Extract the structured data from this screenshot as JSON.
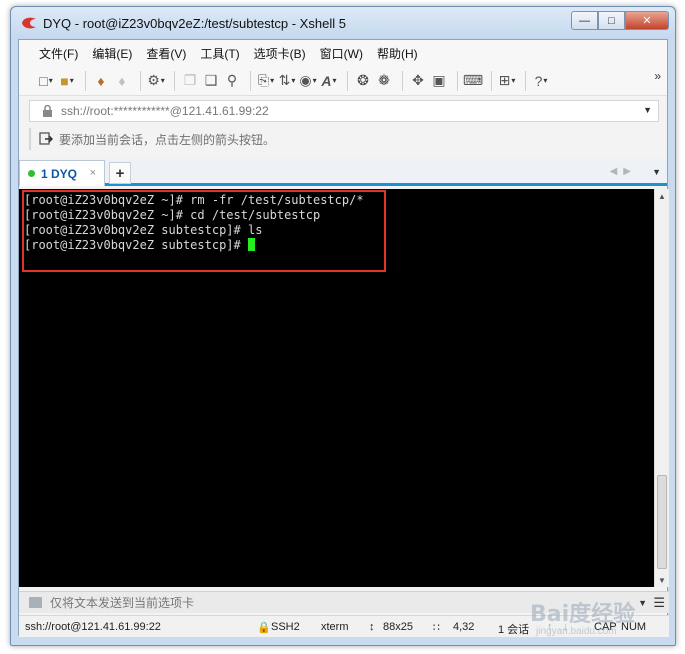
{
  "window": {
    "title": "DYQ - root@iZ23v0bqv2eZ:/test/subtestcp - Xshell 5"
  },
  "menu": {
    "items": [
      "文件(F)",
      "编辑(E)",
      "查看(V)",
      "工具(T)",
      "选项卡(B)",
      "窗口(W)",
      "帮助(H)"
    ]
  },
  "address": {
    "text": "ssh://root:************@121.41.61.99:22"
  },
  "session_hint": {
    "text": "要添加当前会话，点击左侧的箭头按钮。"
  },
  "tabs": [
    {
      "label": "1 DYQ",
      "close": "×"
    }
  ],
  "tab_add": "+",
  "terminal": {
    "lines": [
      "[root@iZ23v0bqv2eZ ~]# rm -fr /test/subtestcp/*",
      "[root@iZ23v0bqv2eZ ~]# cd /test/subtestcp",
      "[root@iZ23v0bqv2eZ subtestcp]# ls",
      "[root@iZ23v0bqv2eZ subtestcp]# "
    ],
    "colors": {
      "background": "#000000",
      "text": "#d8d8d8",
      "cursor": "#22ee22",
      "highlight_border": "#e0332a"
    }
  },
  "compose": {
    "placeholder": "仅将文本发送到当前选项卡"
  },
  "status": {
    "connection": "ssh://root@121.41.61.99:22",
    "protocol": "SSH2",
    "term": "xterm",
    "size": "88x25",
    "cursor_pos": "4,32",
    "sessions": "1 会话",
    "cap": "CAP",
    "num": "NUM"
  },
  "watermark": {
    "text": "Bai度经验",
    "sub": "jingyan.baidu.com"
  }
}
